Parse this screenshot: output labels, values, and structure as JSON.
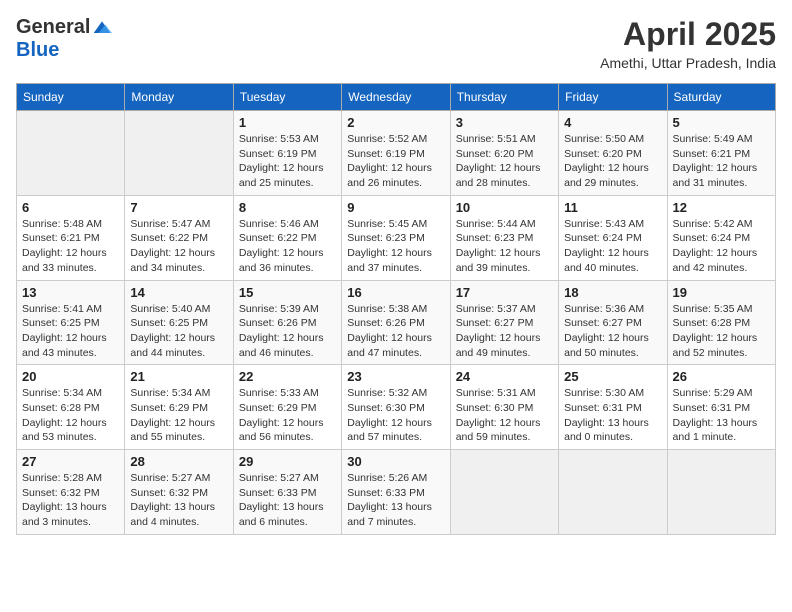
{
  "header": {
    "logo_general": "General",
    "logo_blue": "Blue",
    "month_year": "April 2025",
    "location": "Amethi, Uttar Pradesh, India"
  },
  "days_of_week": [
    "Sunday",
    "Monday",
    "Tuesday",
    "Wednesday",
    "Thursday",
    "Friday",
    "Saturday"
  ],
  "weeks": [
    [
      {
        "day": "",
        "info": ""
      },
      {
        "day": "",
        "info": ""
      },
      {
        "day": "1",
        "info": "Sunrise: 5:53 AM\nSunset: 6:19 PM\nDaylight: 12 hours and 25 minutes."
      },
      {
        "day": "2",
        "info": "Sunrise: 5:52 AM\nSunset: 6:19 PM\nDaylight: 12 hours and 26 minutes."
      },
      {
        "day": "3",
        "info": "Sunrise: 5:51 AM\nSunset: 6:20 PM\nDaylight: 12 hours and 28 minutes."
      },
      {
        "day": "4",
        "info": "Sunrise: 5:50 AM\nSunset: 6:20 PM\nDaylight: 12 hours and 29 minutes."
      },
      {
        "day": "5",
        "info": "Sunrise: 5:49 AM\nSunset: 6:21 PM\nDaylight: 12 hours and 31 minutes."
      }
    ],
    [
      {
        "day": "6",
        "info": "Sunrise: 5:48 AM\nSunset: 6:21 PM\nDaylight: 12 hours and 33 minutes."
      },
      {
        "day": "7",
        "info": "Sunrise: 5:47 AM\nSunset: 6:22 PM\nDaylight: 12 hours and 34 minutes."
      },
      {
        "day": "8",
        "info": "Sunrise: 5:46 AM\nSunset: 6:22 PM\nDaylight: 12 hours and 36 minutes."
      },
      {
        "day": "9",
        "info": "Sunrise: 5:45 AM\nSunset: 6:23 PM\nDaylight: 12 hours and 37 minutes."
      },
      {
        "day": "10",
        "info": "Sunrise: 5:44 AM\nSunset: 6:23 PM\nDaylight: 12 hours and 39 minutes."
      },
      {
        "day": "11",
        "info": "Sunrise: 5:43 AM\nSunset: 6:24 PM\nDaylight: 12 hours and 40 minutes."
      },
      {
        "day": "12",
        "info": "Sunrise: 5:42 AM\nSunset: 6:24 PM\nDaylight: 12 hours and 42 minutes."
      }
    ],
    [
      {
        "day": "13",
        "info": "Sunrise: 5:41 AM\nSunset: 6:25 PM\nDaylight: 12 hours and 43 minutes."
      },
      {
        "day": "14",
        "info": "Sunrise: 5:40 AM\nSunset: 6:25 PM\nDaylight: 12 hours and 44 minutes."
      },
      {
        "day": "15",
        "info": "Sunrise: 5:39 AM\nSunset: 6:26 PM\nDaylight: 12 hours and 46 minutes."
      },
      {
        "day": "16",
        "info": "Sunrise: 5:38 AM\nSunset: 6:26 PM\nDaylight: 12 hours and 47 minutes."
      },
      {
        "day": "17",
        "info": "Sunrise: 5:37 AM\nSunset: 6:27 PM\nDaylight: 12 hours and 49 minutes."
      },
      {
        "day": "18",
        "info": "Sunrise: 5:36 AM\nSunset: 6:27 PM\nDaylight: 12 hours and 50 minutes."
      },
      {
        "day": "19",
        "info": "Sunrise: 5:35 AM\nSunset: 6:28 PM\nDaylight: 12 hours and 52 minutes."
      }
    ],
    [
      {
        "day": "20",
        "info": "Sunrise: 5:34 AM\nSunset: 6:28 PM\nDaylight: 12 hours and 53 minutes."
      },
      {
        "day": "21",
        "info": "Sunrise: 5:34 AM\nSunset: 6:29 PM\nDaylight: 12 hours and 55 minutes."
      },
      {
        "day": "22",
        "info": "Sunrise: 5:33 AM\nSunset: 6:29 PM\nDaylight: 12 hours and 56 minutes."
      },
      {
        "day": "23",
        "info": "Sunrise: 5:32 AM\nSunset: 6:30 PM\nDaylight: 12 hours and 57 minutes."
      },
      {
        "day": "24",
        "info": "Sunrise: 5:31 AM\nSunset: 6:30 PM\nDaylight: 12 hours and 59 minutes."
      },
      {
        "day": "25",
        "info": "Sunrise: 5:30 AM\nSunset: 6:31 PM\nDaylight: 13 hours and 0 minutes."
      },
      {
        "day": "26",
        "info": "Sunrise: 5:29 AM\nSunset: 6:31 PM\nDaylight: 13 hours and 1 minute."
      }
    ],
    [
      {
        "day": "27",
        "info": "Sunrise: 5:28 AM\nSunset: 6:32 PM\nDaylight: 13 hours and 3 minutes."
      },
      {
        "day": "28",
        "info": "Sunrise: 5:27 AM\nSunset: 6:32 PM\nDaylight: 13 hours and 4 minutes."
      },
      {
        "day": "29",
        "info": "Sunrise: 5:27 AM\nSunset: 6:33 PM\nDaylight: 13 hours and 6 minutes."
      },
      {
        "day": "30",
        "info": "Sunrise: 5:26 AM\nSunset: 6:33 PM\nDaylight: 13 hours and 7 minutes."
      },
      {
        "day": "",
        "info": ""
      },
      {
        "day": "",
        "info": ""
      },
      {
        "day": "",
        "info": ""
      }
    ]
  ]
}
